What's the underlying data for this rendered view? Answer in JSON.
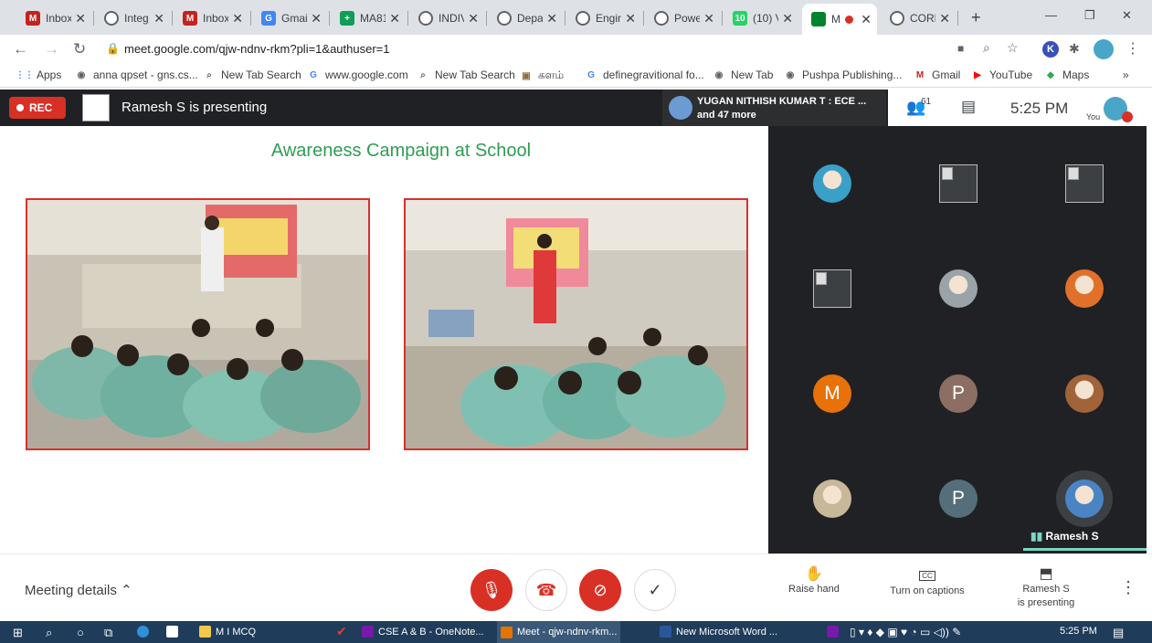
{
  "browser": {
    "tabs": [
      {
        "label": "Inbox",
        "icon": "gmail-icon",
        "color": "#c5221f",
        "glyph": "M"
      },
      {
        "label": "Integ",
        "icon": "globe-icon",
        "color": "#5f6368",
        "glyph": ""
      },
      {
        "label": "Inbox",
        "icon": "gmail-icon",
        "color": "#c5221f",
        "glyph": "M"
      },
      {
        "label": "Gmail",
        "icon": "google-icon",
        "color": "#4285f4",
        "glyph": "G"
      },
      {
        "label": "MA81",
        "icon": "sheets-icon",
        "color": "#0f9d58",
        "glyph": "+"
      },
      {
        "label": "INDIV",
        "icon": "globe-icon",
        "color": "#5f6368",
        "glyph": ""
      },
      {
        "label": "Depa",
        "icon": "globe-icon",
        "color": "#5f6368",
        "glyph": ""
      },
      {
        "label": "Engin",
        "icon": "globe-icon",
        "color": "#5f6368",
        "glyph": ""
      },
      {
        "label": "Powe",
        "icon": "globe-icon",
        "color": "#5f6368",
        "glyph": ""
      },
      {
        "label": "(10) V",
        "icon": "whatsapp-icon",
        "color": "#25d366",
        "glyph": "10"
      },
      {
        "label": "M",
        "icon": "meet-icon",
        "color": "#00832d",
        "glyph": ""
      },
      {
        "label": "CORR",
        "icon": "globe-icon",
        "color": "#5f6368",
        "glyph": ""
      }
    ],
    "new_tab": "+",
    "url": "meet.google.com/qjw-ndnv-rkm?pli=1&authuser=1",
    "bookmarks": [
      {
        "label": "Apps",
        "icon": "apps-icon"
      },
      {
        "label": "anna qpset - gns.cs...",
        "icon": "globe-icon"
      },
      {
        "label": "New Tab Search",
        "icon": "search-icon"
      },
      {
        "label": "www.google.com",
        "icon": "google-icon"
      },
      {
        "label": "New Tab Search",
        "icon": "search-icon"
      },
      {
        "label": "களம்",
        "icon": "image-icon"
      },
      {
        "label": "definegravitional fo...",
        "icon": "google-icon"
      },
      {
        "label": "New Tab",
        "icon": "globe-icon"
      },
      {
        "label": "Pushpa Publishing...",
        "icon": "globe-icon"
      },
      {
        "label": "Gmail",
        "icon": "gmail-icon"
      },
      {
        "label": "YouTube",
        "icon": "youtube-icon"
      },
      {
        "label": "Maps",
        "icon": "maps-icon"
      }
    ],
    "bookmarks_more": "»"
  },
  "meet": {
    "rec_label": "REC",
    "presenting": "Ramesh S is presenting",
    "notification_line1": "YUGAN NITHISH KUMAR T : ECE ...",
    "notification_line2": "and 47 more",
    "participant_count": "61",
    "time": "5:25 PM",
    "you_label": "You",
    "slide_title": "Awareness Campaign at School",
    "speaker_name": "Ramesh S",
    "tiles": [
      {
        "kind": "photo",
        "color": "#3aa0c8"
      },
      {
        "kind": "broken"
      },
      {
        "kind": "broken"
      },
      {
        "kind": "broken"
      },
      {
        "kind": "photo",
        "color": "#9aa3a8"
      },
      {
        "kind": "photo",
        "color": "#e0702a"
      },
      {
        "kind": "letter",
        "letter": "M",
        "color": "#e8710a"
      },
      {
        "kind": "letter",
        "letter": "P",
        "color": "#8d6e63"
      },
      {
        "kind": "photo",
        "color": "#a0633a"
      },
      {
        "kind": "photo",
        "color": "#c8b89a"
      },
      {
        "kind": "letter",
        "letter": "P",
        "color": "#546e7a"
      },
      {
        "kind": "photo",
        "color": "#4a84c4"
      }
    ],
    "meeting_details": "Meeting details",
    "raise_hand": "Raise hand",
    "captions": "Turn on captions",
    "presenting_line1": "Ramesh S",
    "presenting_line2": "is presenting",
    "cc_label": "CC"
  },
  "taskbar": {
    "items": [
      {
        "label": "M I MCQ",
        "color": "#f2c94c"
      },
      {
        "label": "CSE A & B - OneNote...",
        "color": "#7719aa"
      },
      {
        "label": "Meet - qjw-ndnv-rkm...",
        "color": "#e37400"
      },
      {
        "label": "New Microsoft Word ...",
        "color": "#2b579a"
      }
    ],
    "time": "5:25 PM"
  },
  "colors": {
    "accent_red": "#d93025",
    "slide_title": "#2e9d52",
    "grid_bg": "#202124"
  }
}
